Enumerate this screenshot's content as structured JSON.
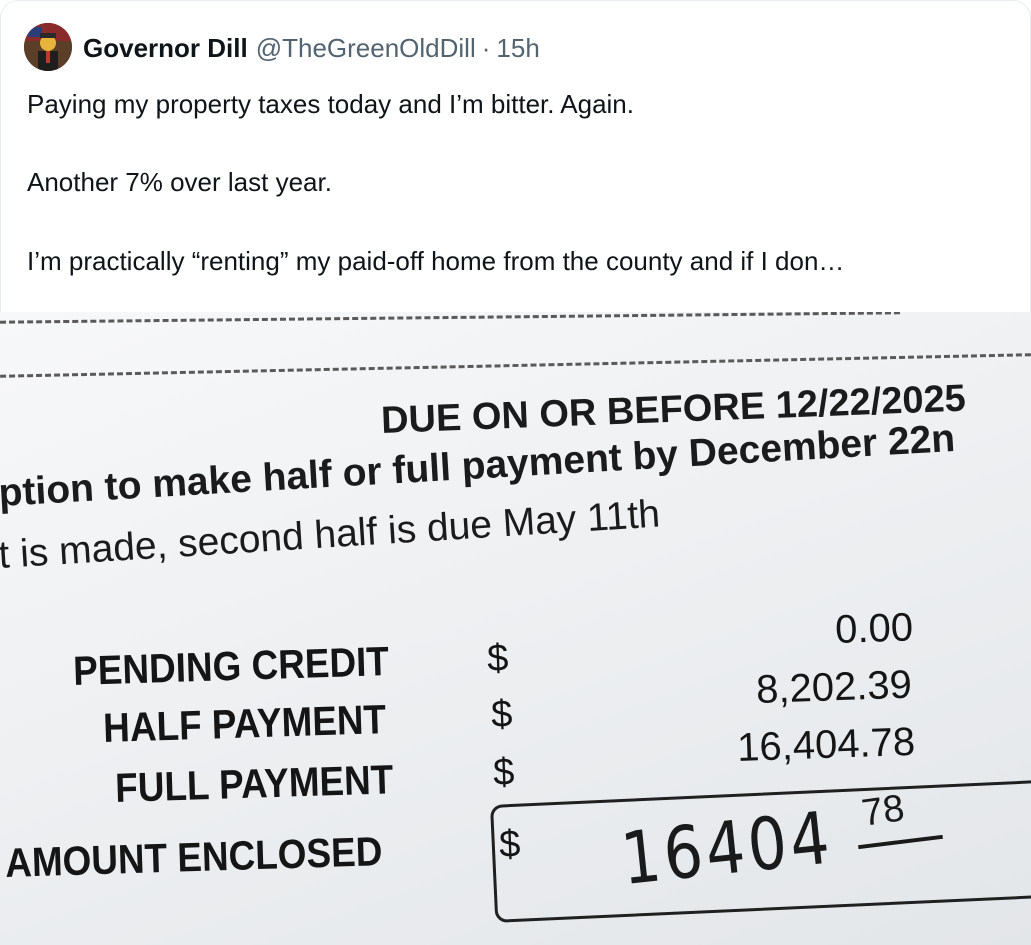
{
  "tweet": {
    "display_name": "Governor Dill",
    "handle": "@TheGreenOldDill",
    "separator": "·",
    "time": "15h",
    "lines": [
      "Paying my property taxes today and I’m bitter. Again.",
      "Another 7% over last year.",
      "I’m practically “renting” my paid-off home from the county and if I don…"
    ]
  },
  "bill": {
    "due_heading": "DUE ON OR BEFORE 12/22/2025",
    "option_line": "ption to make half or full payment by December 22n",
    "second_half_line": "t is made, second half is due May 11th",
    "rows": [
      {
        "label": "PENDING CREDIT",
        "currency": "$",
        "amount": "0.00"
      },
      {
        "label": "HALF PAYMENT",
        "currency": "$",
        "amount": "8,202.39"
      },
      {
        "label": "FULL PAYMENT",
        "currency": "$",
        "amount": "16,404.78"
      }
    ],
    "enclosed_label": "AMOUNT ENCLOSED",
    "enclosed_currency": "$",
    "handwritten_dollars": "16404",
    "handwritten_cents": "78"
  }
}
